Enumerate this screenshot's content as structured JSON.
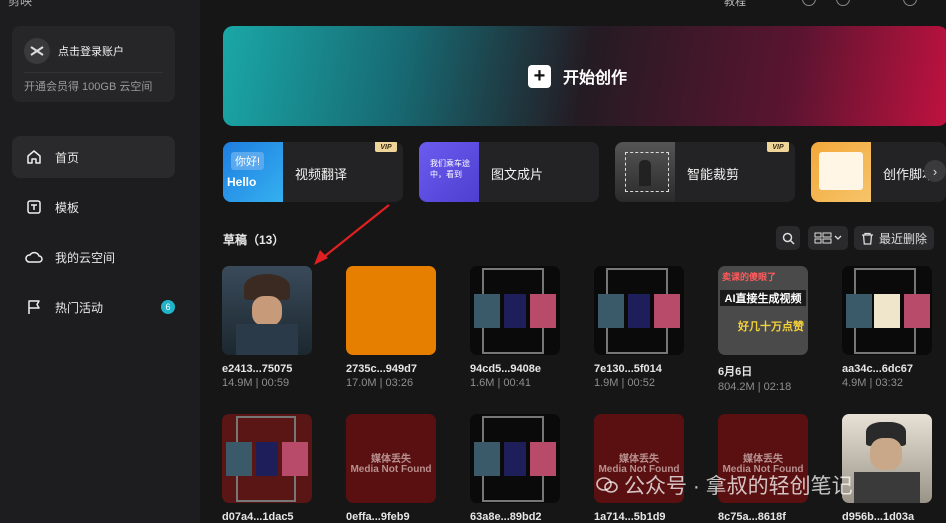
{
  "app": {
    "title": "剪映"
  },
  "account": {
    "login": "点击登录账户",
    "vip_promo": "开通会员得 100GB 云空间"
  },
  "nav": [
    {
      "label": "首页",
      "icon": "home-icon",
      "active": true
    },
    {
      "label": "模板",
      "icon": "template-icon",
      "active": false
    },
    {
      "label": "我的云空间",
      "icon": "cloud-icon",
      "active": false
    },
    {
      "label": "热门活动",
      "icon": "flag-icon",
      "active": false,
      "badge": "6"
    }
  ],
  "header": {
    "tutorial": "教程"
  },
  "start": {
    "label": "开始创作"
  },
  "tools": [
    {
      "label": "视频翻译",
      "thumb_text_top": "你好!",
      "thumb_text_bottom": "Hello",
      "vip": "VIP"
    },
    {
      "label": "图文成片",
      "thumb_text": "我们乘车途中，看到",
      "vip": ""
    },
    {
      "label": "智能裁剪",
      "vip": "VIP"
    },
    {
      "label": "创作脚本",
      "vip": ""
    }
  ],
  "drafts": {
    "title": "草稿（13）",
    "recent_delete": "最近删除",
    "items": [
      {
        "name": "e2413...75075",
        "meta": "14.9M | 00:59",
        "thumb": "anime"
      },
      {
        "name": "2735c...949d7",
        "meta": "17.0M | 03:26",
        "thumb": "orange"
      },
      {
        "name": "94cd5...9408e",
        "meta": "1.6M | 00:41",
        "thumb": "triptych-red"
      },
      {
        "name": "7e130...5f014",
        "meta": "1.9M | 00:52",
        "thumb": "triptych-red"
      },
      {
        "name": "6月6日",
        "meta": "804.2M | 02:18",
        "thumb": "ai",
        "thumb_text_top": "卖课的傻眼了",
        "thumb_text_mid": "AI直接生成视频",
        "thumb_text_bottom": "好几十万点赞"
      },
      {
        "name": "aa34c...6dc67",
        "meta": "4.9M | 03:32",
        "thumb": "triptych-beige"
      },
      {
        "name": "d07a4...1dac5",
        "meta": "",
        "thumb": "triptych-dark-red"
      },
      {
        "name": "0effa...9feb9",
        "meta": "",
        "thumb": "missing",
        "thumb_text_top": "媒体丢失",
        "thumb_text_bottom": "Media Not Found"
      },
      {
        "name": "63a8e...89bd2",
        "meta": "",
        "thumb": "triptych-red"
      },
      {
        "name": "1a714...5b1d9",
        "meta": "",
        "thumb": "missing",
        "thumb_text_top": "媒体丢失",
        "thumb_text_bottom": "Media Not Found"
      },
      {
        "name": "8c75a...8618f",
        "meta": "",
        "thumb": "missing",
        "thumb_text_top": "媒体丢失",
        "thumb_text_bottom": "Media Not Found"
      },
      {
        "name": "d956b...1d03a",
        "meta": "",
        "thumb": "portrait"
      }
    ]
  },
  "watermark": {
    "text": "公众号 · 拿叔的轻创笔记"
  },
  "colors": {
    "accent_teal": "#1fb4c9",
    "banner_left": "#1aa7a7",
    "banner_right": "#c0123f",
    "arrow_red": "#e02020",
    "vip_gold": "#f0d59a"
  }
}
